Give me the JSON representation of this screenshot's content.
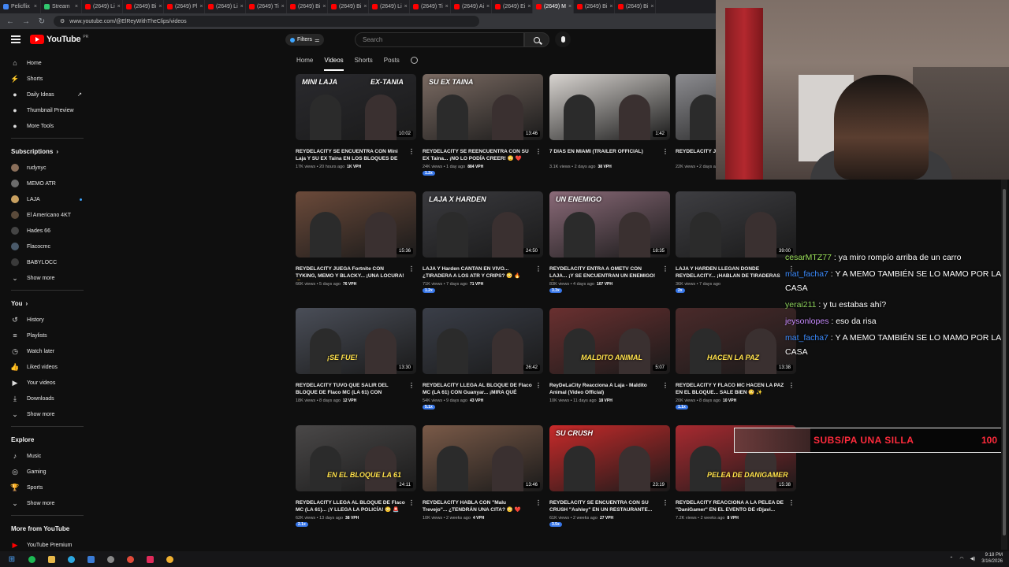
{
  "browser": {
    "tabs": [
      {
        "label": "Pelicflix",
        "color": "#4285f4"
      },
      {
        "label": "Stream",
        "color": "#31c86e"
      },
      {
        "label": "(2649) Li",
        "color": "#ff0000"
      },
      {
        "label": "(2649) Bi",
        "color": "#ff0000"
      },
      {
        "label": "(2649) Pl",
        "color": "#ff0000"
      },
      {
        "label": "(2649) Li",
        "color": "#ff0000"
      },
      {
        "label": "(2649) Ti",
        "color": "#ff0000"
      },
      {
        "label": "(2649) Bi",
        "color": "#ff0000"
      },
      {
        "label": "(2649) Bi",
        "color": "#ff0000"
      },
      {
        "label": "(2649) Li",
        "color": "#ff0000"
      },
      {
        "label": "(2649) Ti",
        "color": "#ff0000"
      },
      {
        "label": "(2649) Ai",
        "color": "#ff0000"
      },
      {
        "label": "(2649) Ei",
        "color": "#ff0000"
      },
      {
        "label": "(2649) M",
        "color": "#ff0000"
      },
      {
        "label": "(2649) Bi",
        "color": "#ff0000"
      },
      {
        "label": "(2649) Bi",
        "color": "#ff0000"
      }
    ],
    "url": "www.youtube.com/@ElReyWithTheClips/videos"
  },
  "masthead": {
    "logo": "YouTube",
    "logo_country": "PR",
    "filters_label": "Filters",
    "search_placeholder": "Search"
  },
  "channel_tabs": [
    "Home",
    "Videos",
    "Shorts",
    "Posts"
  ],
  "sidebar": {
    "top": [
      {
        "label": "Home",
        "icon": "⌂"
      },
      {
        "label": "Shorts",
        "icon": "⚡"
      },
      {
        "label": "Daily Ideas",
        "icon": "●",
        "external": "↗"
      },
      {
        "label": "Thumbnail Preview",
        "icon": "●"
      },
      {
        "label": "More Tools",
        "icon": "●"
      }
    ],
    "subscriptions_heading": "Subscriptions",
    "subscriptions": [
      {
        "label": "rudynyc",
        "color": "#8a6f5a"
      },
      {
        "label": "MEMO ATR",
        "color": "#6c6c6c"
      },
      {
        "label": "LAJA",
        "color": "#c8a060",
        "new": true
      },
      {
        "label": "El Americano 4KT",
        "color": "#5a4a3a"
      },
      {
        "label": "Hades 66",
        "color": "#444"
      },
      {
        "label": "Flacocmc",
        "color": "#4a5a6a"
      },
      {
        "label": "BABYLOCC",
        "color": "#3a3a3a"
      }
    ],
    "show_more": "Show more",
    "you_heading": "You",
    "you_items": [
      {
        "label": "History",
        "icon": "↺"
      },
      {
        "label": "Playlists",
        "icon": "≡"
      },
      {
        "label": "Watch later",
        "icon": "◷"
      },
      {
        "label": "Liked videos",
        "icon": "👍"
      },
      {
        "label": "Your videos",
        "icon": "▶"
      },
      {
        "label": "Downloads",
        "icon": "⤓"
      }
    ],
    "show_more_2": "Show more",
    "explore_heading": "Explore",
    "explore_items": [
      {
        "label": "Music",
        "icon": "♪"
      },
      {
        "label": "Gaming",
        "icon": "◎"
      },
      {
        "label": "Sports",
        "icon": "🏆"
      }
    ],
    "show_more_3": "Show more",
    "more_heading": "More from YouTube",
    "more_items": [
      {
        "label": "YouTube Premium",
        "icon": "▶"
      }
    ]
  },
  "videos": [
    {
      "overlay": "MINI LAJA",
      "overlay2": "EX-TANIA",
      "duration": "10:02",
      "title": "REYDELACITY SE ENCUENTRA CON Mini Laja Y SU EX Taina EN LOS BLOQUES DE N...",
      "meta": "17K views • 20 hours ago",
      "vph": "1K VPH",
      "bg": "#2a2a2e"
    },
    {
      "overlay": "SU EX TAINA",
      "duration": "13:46",
      "title": "REYDELACITY SE REENCUENTRA CON SU EX Taina... ¡NO LO PODÍA CREER! 😳 ❤️",
      "meta": "24K views • 1 day ago",
      "vph": "884 VPH",
      "vph_x": "1.2x",
      "bg": "#7a6a62"
    },
    {
      "overlay": "",
      "duration": "1:42",
      "title": "7 DIAS EN MIAMI (TRAILER OFFICIAL)",
      "meta": "3.1K views • 2 days ago",
      "vph": "38 VPH",
      "bg": "#d8d4d0"
    },
    {
      "overlay": "",
      "duration": "",
      "title": "REYDELACITY J... BabyLocc, Y Ma...",
      "meta": "22K views • 2 days ago",
      "vph": "",
      "bg": "#8c8c90"
    },
    {
      "overlay": "",
      "duration": "15:36",
      "title": "REYDELACITY JUEGA Fortnite CON TYKING, MEMO Y BLACKY... ¡UNA LOCURA! 😂 🎮",
      "meta": "66K views • 5 days ago",
      "vph": "76 VPH",
      "bg": "#6b4a3a"
    },
    {
      "overlay": "LAJA X HARDEN",
      "duration": "24:50",
      "title": "LAJA Y Harden CANTAN EN VIVO... ¿TIRADERA A LOS ATR Y CRIPS? 😳 🔥",
      "meta": "71K views • 7 days ago",
      "vph": "71 VPH",
      "vph_x": "1.2x",
      "bg": "#3a3a3e"
    },
    {
      "overlay": "UN ENEMIGO",
      "duration": "18:35",
      "title": "REYDELACITY ENTRA A OMETV CON LAJA... ¡Y SE ENCUENTRAN UN ENEMIGO! 😳 🔥",
      "meta": "83K views • 4 days ago",
      "vph": "107 VPH",
      "vph_x": "3.3x",
      "bg": "#8a6a78"
    },
    {
      "overlay": "",
      "duration": "39:00",
      "title": "LAJA Y HARDEN LLEGAN DONDE REYDELACITY... ¡HABLAN DE TIRADERAS Y...",
      "meta": "36K views • 7 days ago",
      "vph": "",
      "vph_x": "2x",
      "bg": "#3e3e42"
    },
    {
      "overlay": "",
      "duration": "13:30",
      "title": "REYDELACITY TUVO QUE SALIR DEL BLOQUE DE Flaco MC (LA 61) CON Guanya...",
      "meta": "18K views • 8 days ago",
      "vph": "12 VPH",
      "bg": "#4a4e58",
      "big": "¡SE FUE!"
    },
    {
      "overlay": "",
      "duration": "26:42",
      "title": "REYDELACITY LLEGA AL BLOQUE DE Flaco MC (LA 61) CON Guanyar... ¡MIRA QUÉ PAS...",
      "meta": "54K views • 9 days ago",
      "vph": "43 VPH",
      "vph_x": "5.1x",
      "bg": "#3a3e48"
    },
    {
      "overlay": "",
      "duration": "5:07",
      "title": "ReyDeLaCity Reacciona A Laja - Maldito Animal (Video Official)",
      "meta": "10K views • 11 days ago",
      "vph": "18 VPH",
      "bg": "#6a3030",
      "big": "MALDITO ANIMAL"
    },
    {
      "overlay": "",
      "duration": "13:38",
      "title": "REYDELACITY Y FLACO MC HACEN LA PAZ EN EL BLOQUE... SALE BIEN 😳 ✨",
      "meta": "20K views • 8 days ago",
      "vph": "10 VPH",
      "vph_x": "1.1x",
      "bg": "#4a2a2a",
      "big": "HACEN LA PAZ"
    },
    {
      "overlay": "",
      "duration": "24:11",
      "title": "REYDELACITY LLEGA AL BLOQUE DE Flaco MC (LA 61)... ¡Y LLEGA LA POLICÍA! 😳 🚨",
      "meta": "62K views • 13 days ago",
      "vph": "38 VPH",
      "vph_x": "2.1x",
      "bg": "#4a4848",
      "big": "EN EL BLOQUE LA 61"
    },
    {
      "overlay": "",
      "duration": "13:46",
      "title": "REYDELACITY HABLA CON \"Malu Trevejo\"... ¿TENDRÁN UNA CITA? 😳 ❤️",
      "meta": "10K views • 2 weeks ago",
      "vph": "4 VPH",
      "bg": "#7a5a48"
    },
    {
      "overlay": "SU CRUSH",
      "duration": "23:19",
      "title": "REYDELACITY SE ENCUENTRA CON SU CRUSH \"Ashley\" EN UN RESTAURANTE... Y...",
      "meta": "61K views • 2 weeks ago",
      "vph": "27 VPH",
      "vph_x": "3.5x",
      "bg": "#c82a2a"
    },
    {
      "overlay": "",
      "duration": "15:38",
      "title": "REYDELACITY REACCIONA A LA PELEA DE \"DaniGamer\" EN EL EVENTO DE rDjavi... ¡N...",
      "meta": "7.2K views • 2 weeks ago",
      "vph": "8 VPH",
      "bg": "#a82a30",
      "big": "PELEA DE DANIGAMER"
    }
  ],
  "chat": [
    {
      "user": "cesarMTZ77",
      "color": "#9be05a",
      "text": "ya miro rompío arriba de un carro"
    },
    {
      "user": "mat_facha7",
      "color": "#3c8cff",
      "text": "Y A MEMO TAMBIÉN SE LO MAMO POR LA CASA"
    },
    {
      "user": "yerai211",
      "color": "#8bd05a",
      "text": "y tu estabas ahí?"
    },
    {
      "user": "jeysonlopes",
      "color": "#c88cff",
      "text": "eso da risa"
    },
    {
      "user": "mat_facha7",
      "color": "#3c8cff",
      "text": "Y A MEMO TAMBIÉN SE LO MAMO POR LA CASA"
    }
  ],
  "goal": {
    "label": "SUBS/PA UNA SILLA",
    "count": "100"
  },
  "clock": {
    "time": "9:18 PM",
    "date": "3/16/2026"
  }
}
